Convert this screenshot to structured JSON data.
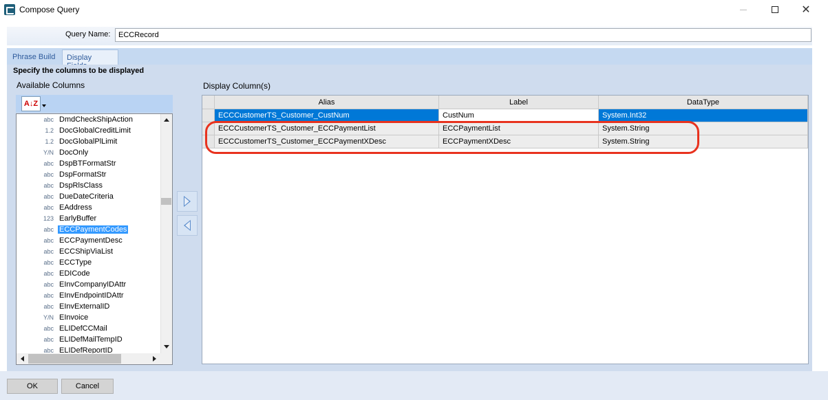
{
  "window": {
    "title": "Compose Query"
  },
  "query": {
    "label": "Query Name:",
    "value": "ECCRecord"
  },
  "tabs": [
    {
      "label": "Phrase Build",
      "active": false
    },
    {
      "label": "Display Fields",
      "active": true
    }
  ],
  "instructions": "Specify the columns to be displayed",
  "available": {
    "label": "Available Columns",
    "sort_icon": "sort-az-icon",
    "items": [
      {
        "type": "abc",
        "name": "DmdCheckShipAction"
      },
      {
        "type": "1.2",
        "name": "DocGlobalCreditLimit"
      },
      {
        "type": "1.2",
        "name": "DocGlobalPlLimit"
      },
      {
        "type": "Y/N",
        "name": "DocOnly"
      },
      {
        "type": "abc",
        "name": "DspBTFormatStr"
      },
      {
        "type": "abc",
        "name": "DspFormatStr"
      },
      {
        "type": "abc",
        "name": "DspRlsClass"
      },
      {
        "type": "abc",
        "name": "DueDateCriteria"
      },
      {
        "type": "abc",
        "name": "EAddress"
      },
      {
        "type": "123",
        "name": "EarlyBuffer"
      },
      {
        "type": "abc",
        "name": "ECCPaymentCodes",
        "selected": true
      },
      {
        "type": "abc",
        "name": "ECCPaymentDesc"
      },
      {
        "type": "abc",
        "name": "ECCShipViaList"
      },
      {
        "type": "abc",
        "name": "ECCType"
      },
      {
        "type": "abc",
        "name": "EDICode"
      },
      {
        "type": "abc",
        "name": "EInvCompanyIDAttr"
      },
      {
        "type": "abc",
        "name": "EInvEndpointIDAttr"
      },
      {
        "type": "abc",
        "name": "EInvExternalID"
      },
      {
        "type": "Y/N",
        "name": "EInvoice"
      },
      {
        "type": "abc",
        "name": "ELIDefCCMail"
      },
      {
        "type": "abc",
        "name": "ELIDefMailTempID"
      },
      {
        "type": "abc",
        "name": "ELIDefReportID"
      }
    ]
  },
  "display": {
    "label": "Display Column(s)",
    "headers": [
      "Alias",
      "Label",
      "DataType"
    ],
    "rows": [
      {
        "alias": "ECCCustomerTS_Customer_CustNum",
        "label": "CustNum",
        "datatype": "System.Int32"
      },
      {
        "alias": "ECCCustomerTS_Customer_ECCPaymentList",
        "label": "ECCPaymentList",
        "datatype": "System.String"
      },
      {
        "alias": "ECCCustomerTS_Customer_ECCPaymentXDesc",
        "label": "ECCPaymentXDesc",
        "datatype": "System.String"
      }
    ]
  },
  "buttons": {
    "ok": "OK",
    "cancel": "Cancel"
  },
  "colors": {
    "selection": "#0078d7",
    "list_selection": "#3399ff",
    "annotation": "#e8321e",
    "panel": "#cfdcee"
  }
}
